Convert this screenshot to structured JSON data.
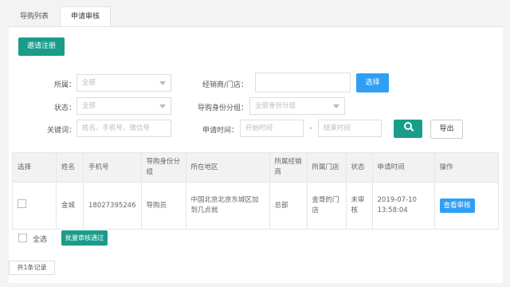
{
  "tabs": [
    {
      "label": "导购列表",
      "active": false
    },
    {
      "label": "申请审核",
      "active": true
    }
  ],
  "invite_button": "邀请注册",
  "filters": {
    "affiliation_label": "所属：",
    "affiliation_value": "全部",
    "dealer_label": "经销商/门店：",
    "dealer_value": "",
    "select_button": "选择",
    "status_label": "状态：",
    "status_value": "全部",
    "group_label": "导购身份分组：",
    "group_value": "全部身份分组",
    "keyword_label": "关键词：",
    "keyword_placeholder": "姓名、手机号、微信号",
    "time_label": "申请时间：",
    "start_placeholder": "开始时间",
    "dash": "-",
    "end_placeholder": "结束时间",
    "export_button": "导出"
  },
  "table": {
    "headers": [
      "选择",
      "姓名",
      "手机号",
      "导购身份分组",
      "所在地区",
      "所属经销商",
      "所属门店",
      "状态",
      "申请时间",
      "操作"
    ],
    "rows": [
      {
        "name": "金城",
        "phone": "18027395246",
        "group": "导购员",
        "region": "中国北京北京东城区加到几点就",
        "dealer": "总部",
        "store": "金哥的门店",
        "status": "未审核",
        "time": "2019-07-10 13:58:04",
        "action": "查看审核"
      }
    ]
  },
  "footer": {
    "select_all": "全选",
    "batch_button": "批量审核通过",
    "total": "共1条记录"
  },
  "colors": {
    "green": "#1a9c8b",
    "blue": "#2e9ff5"
  }
}
